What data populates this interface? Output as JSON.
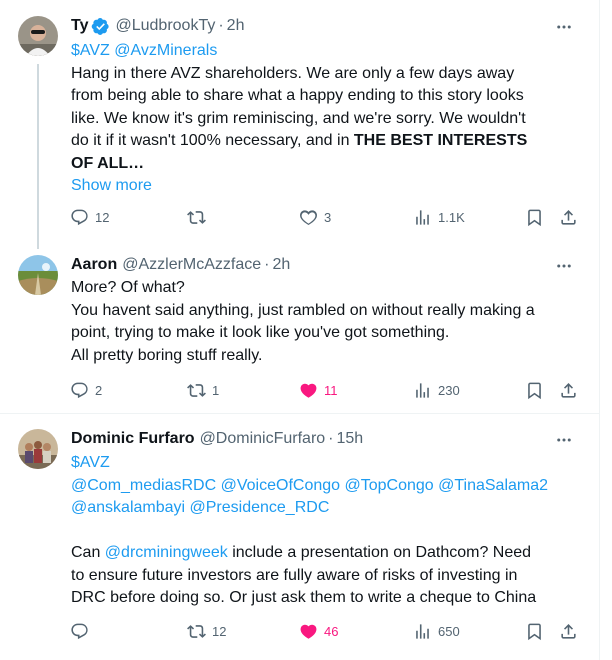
{
  "tweets": [
    {
      "name": "Ty",
      "handle": "@LudbrookTy",
      "dot": "·",
      "time": "2h",
      "lines": [
        "$AVZ @AvzMinerals",
        "Hang in there AVZ shareholders. We are only a few days away",
        "from being able to share what a happy ending to this story looks",
        "like. We know it's grim reminiscing, and we're sorry. We wouldn't",
        "do it if it wasn't 100% necessary, and in ",
        "THE BEST INTERESTS",
        "OF ALL…"
      ],
      "show_more": "Show more",
      "replies": "12",
      "retweets": "",
      "likes": "3",
      "views": "1.1K"
    },
    {
      "name": "Aaron",
      "handle": "@AzzlerMcAzzface",
      "dot": "·",
      "time": "2h",
      "lines": [
        "More? Of what?",
        "You havent said anything, just rambled on without really making a",
        "point, trying to make it look like you've got something.",
        "All pretty boring stuff really."
      ],
      "replies": "2",
      "retweets": "1",
      "likes": "11",
      "views": "230"
    },
    {
      "name": "Dominic Furfaro",
      "handle": "@DominicFurfaro",
      "dot": "·",
      "time": "15h",
      "lines": [
        "$AVZ",
        "@Com_mediasRDC @VoiceOfCongo @TopCongo @TinaSalama2",
        "@anskalambayi @Presidence_RDC",
        "Can ",
        "@drcminingweek",
        " include a presentation on Dathcom? Need",
        "to ensure future investors are fully aware of risks of investing in",
        "DRC before doing so. Or just ask them to write a cheque to China"
      ],
      "replies": "",
      "retweets": "12",
      "likes": "46",
      "views": "650"
    }
  ],
  "colors": {
    "link": "#1d9bf0",
    "like_active": "#f91880",
    "muted": "#536471"
  },
  "icons": [
    "more-icon",
    "verified-badge-icon",
    "reply-icon",
    "retweet-icon",
    "like-icon",
    "views-icon",
    "bookmark-icon",
    "share-icon"
  ]
}
